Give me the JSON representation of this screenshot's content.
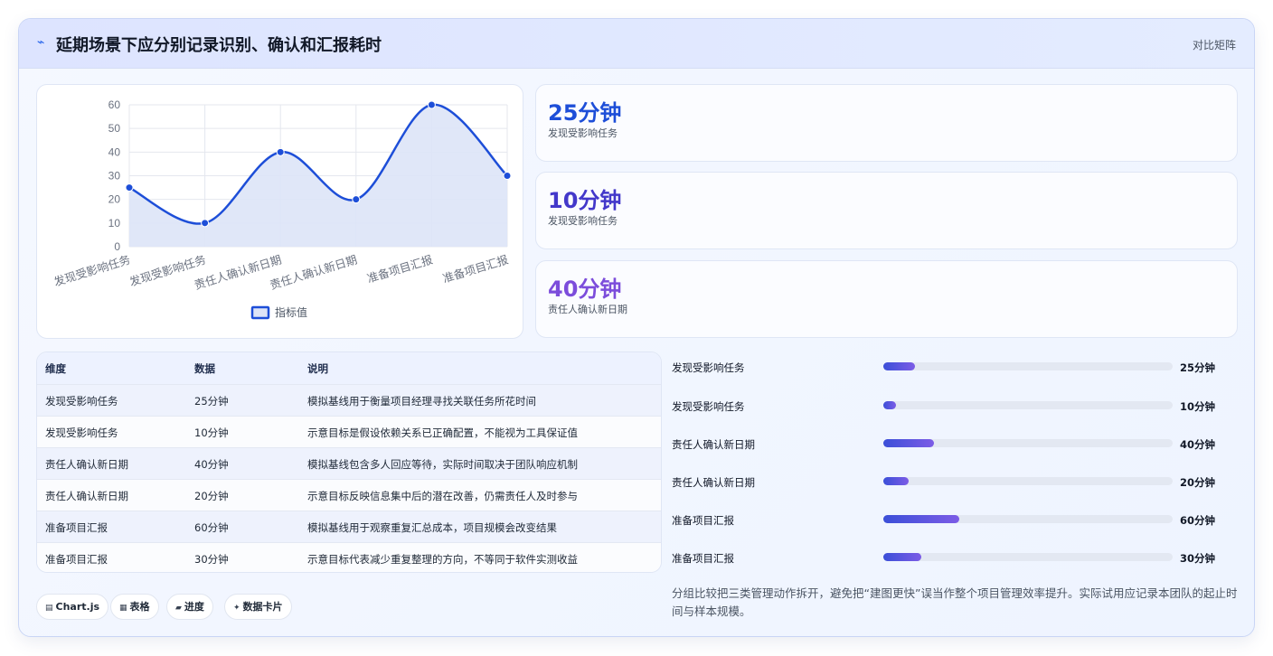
{
  "header": {
    "icon": "trend-icon",
    "title": "延期场景下应分别记录识别、确认和汇报耗时",
    "tag": "对比矩阵"
  },
  "chart_data": {
    "type": "line",
    "categories": [
      "发现受影响任务",
      "发现受影响任务",
      "责任人确认新日期",
      "责任人确认新日期",
      "准备项目汇报",
      "准备项目汇报"
    ],
    "series": [
      {
        "name": "指标值",
        "values": [
          25,
          10,
          40,
          20,
          60,
          30
        ]
      }
    ],
    "ylim": [
      0,
      60
    ],
    "yticks": [
      "60",
      "50",
      "40",
      "30",
      "20",
      "10",
      "0"
    ],
    "grid": true,
    "fill": true,
    "legend_position": "bottom",
    "colors": {
      "line": "#1d4ed8",
      "fill": "#dde4f7"
    }
  },
  "stats": [
    {
      "value": "25分钟",
      "label": "发现受影响任务",
      "color": "#1d4ed8"
    },
    {
      "value": "10分钟",
      "label": "发现受影响任务",
      "color": "#4338ca"
    },
    {
      "value": "40分钟",
      "label": "责任人确认新日期",
      "color": "#7c4ddb"
    }
  ],
  "table": {
    "headers": [
      "维度",
      "数据",
      "说明"
    ],
    "rows": [
      [
        "发现受影响任务",
        "25分钟",
        "模拟基线用于衡量项目经理寻找关联任务所花时间"
      ],
      [
        "发现受影响任务",
        "10分钟",
        "示意目标是假设依赖关系已正确配置，不能视为工具保证值"
      ],
      [
        "责任人确认新日期",
        "40分钟",
        "模拟基线包含多人回应等待，实际时间取决于团队响应机制"
      ],
      [
        "责任人确认新日期",
        "20分钟",
        "示意目标反映信息集中后的潜在改善，仍需责任人及时参与"
      ],
      [
        "准备项目汇报",
        "60分钟",
        "模拟基线用于观察重复汇总成本，项目规模会改变结果"
      ],
      [
        "准备项目汇报",
        "30分钟",
        "示意目标代表减少重复整理的方向，不等同于软件实测收益"
      ]
    ]
  },
  "progress": [
    {
      "label": "发现受影响任务",
      "value": "25分钟",
      "fraction": 0.1094
    },
    {
      "label": "发现受影响任务",
      "value": "10分钟",
      "fraction": 0.0438
    },
    {
      "label": "责任人确认新日期",
      "value": "40分钟",
      "fraction": 0.175
    },
    {
      "label": "责任人确认新日期",
      "value": "20分钟",
      "fraction": 0.0875
    },
    {
      "label": "准备项目汇报",
      "value": "60分钟",
      "fraction": 0.2625
    },
    {
      "label": "准备项目汇报",
      "value": "30分钟",
      "fraction": 0.1313
    }
  ],
  "note": "分组比较把三类管理动作拆开，避免把“建图更快”误当作整个项目管理效率提升。实际试用应记录本团队的起止时间与样本规模。",
  "chips": [
    {
      "icon": "▤",
      "label": "Chart.js"
    },
    {
      "icon": "▦",
      "label": "表格"
    },
    {
      "icon": "▰",
      "label": "进度"
    },
    {
      "icon": "✦",
      "label": "数据卡片"
    }
  ]
}
